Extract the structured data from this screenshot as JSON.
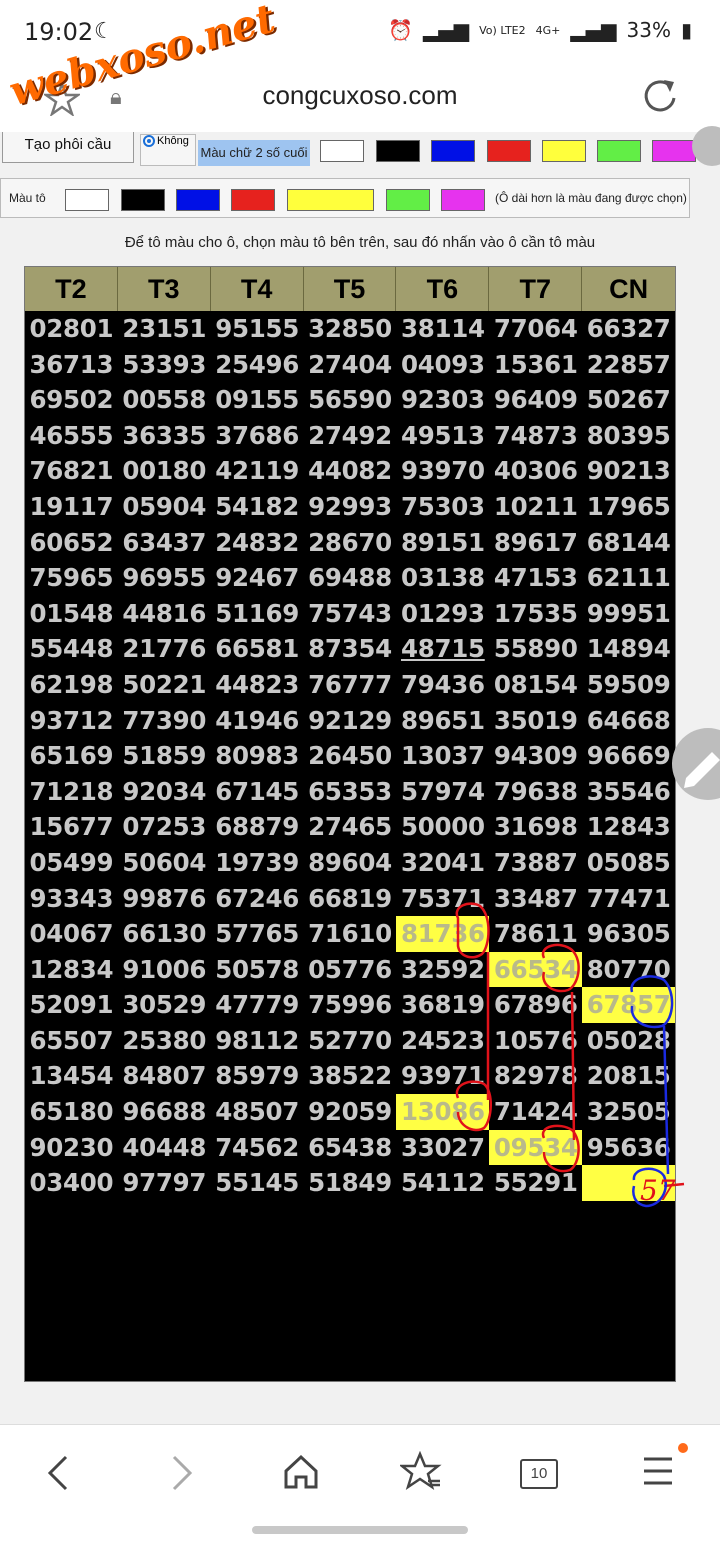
{
  "status_bar": {
    "time": "19:02",
    "battery": "33%",
    "network1": "Vo) LTE2",
    "network2": "4G+"
  },
  "watermark": "webxoso.net",
  "address_bar": {
    "url": "congcuxoso.com"
  },
  "toolbar": {
    "create_button": "Tạo phôi cầu",
    "radio_label": "Không",
    "last2_label": "Màu chữ 2 số cuối",
    "fill_label": "Màu tô",
    "note": "(Ô dài hơn là màu đang được chọn)",
    "colors": [
      "#ffffff",
      "#000000",
      "#0010e6",
      "#e6221e",
      "#ffff3c",
      "#62ee46",
      "#e633ee"
    ]
  },
  "instruction": "Để tô màu cho ô, chọn màu tô bên trên, sau đó nhấn vào ô cần tô màu",
  "table": {
    "headers": [
      "T2",
      "T3",
      "T4",
      "T5",
      "T6",
      "T7",
      "CN"
    ],
    "rows": [
      [
        "02801",
        "23151",
        "95155",
        "32850",
        "38114",
        "77064",
        "66327"
      ],
      [
        "36713",
        "53393",
        "25496",
        "27404",
        "04093",
        "15361",
        "22857"
      ],
      [
        "69502",
        "00558",
        "09155",
        "56590",
        "92303",
        "96409",
        "50267"
      ],
      [
        "46555",
        "36335",
        "37686",
        "27492",
        "49513",
        "74873",
        "80395"
      ],
      [
        "76821",
        "00180",
        "42119",
        "44082",
        "93970",
        "40306",
        "90213"
      ],
      [
        "19117",
        "05904",
        "54182",
        "92993",
        "75303",
        "10211",
        "17965"
      ],
      [
        "60652",
        "63437",
        "24832",
        "28670",
        "89151",
        "89617",
        "68144"
      ],
      [
        "75965",
        "96955",
        "92467",
        "69488",
        "03138",
        "47153",
        "62111"
      ],
      [
        "01548",
        "44816",
        "51169",
        "75743",
        "01293",
        "17535",
        "99951"
      ],
      [
        "55448",
        "21776",
        "66581",
        "87354",
        "48715",
        "55890",
        "14894"
      ],
      [
        "62198",
        "50221",
        "44823",
        "76777",
        "79436",
        "08154",
        "59509"
      ],
      [
        "93712",
        "77390",
        "41946",
        "92129",
        "89651",
        "35019",
        "64668"
      ],
      [
        "65169",
        "51859",
        "80983",
        "26450",
        "13037",
        "94309",
        "96669"
      ],
      [
        "71218",
        "92034",
        "67145",
        "65353",
        "57974",
        "79638",
        "35546"
      ],
      [
        "15677",
        "07253",
        "68879",
        "27465",
        "50000",
        "31698",
        "12843"
      ],
      [
        "05499",
        "50604",
        "19739",
        "89604",
        "32041",
        "73887",
        "05085"
      ],
      [
        "93343",
        "99876",
        "67246",
        "66819",
        "75371",
        "33487",
        "77471"
      ],
      [
        "04067",
        "66130",
        "57765",
        "71610",
        "81736",
        "78611",
        "96305"
      ],
      [
        "12834",
        "91006",
        "50578",
        "05776",
        "32592",
        "66534",
        "80770"
      ],
      [
        "52091",
        "30529",
        "47779",
        "75996",
        "36819",
        "67896",
        "67857"
      ],
      [
        "65507",
        "25380",
        "98112",
        "52770",
        "24523",
        "10576",
        "05028"
      ],
      [
        "13454",
        "84807",
        "85979",
        "38522",
        "93971",
        "82978",
        "20815"
      ],
      [
        "65180",
        "96688",
        "48507",
        "92059",
        "13086",
        "71424",
        "32505"
      ],
      [
        "90230",
        "40448",
        "74562",
        "65438",
        "33027",
        "09534",
        "95636"
      ],
      [
        "03400",
        "97797",
        "55145",
        "51849",
        "54112",
        "55291",
        ""
      ]
    ],
    "highlighted": [
      [
        17,
        4
      ],
      [
        18,
        5
      ],
      [
        19,
        6
      ],
      [
        22,
        4
      ],
      [
        23,
        5
      ],
      [
        24,
        6
      ]
    ],
    "underlined": [
      [
        9,
        4
      ]
    ]
  },
  "annotations": {
    "handwritten_note": "57"
  },
  "nav": {
    "tab_count": "10"
  }
}
